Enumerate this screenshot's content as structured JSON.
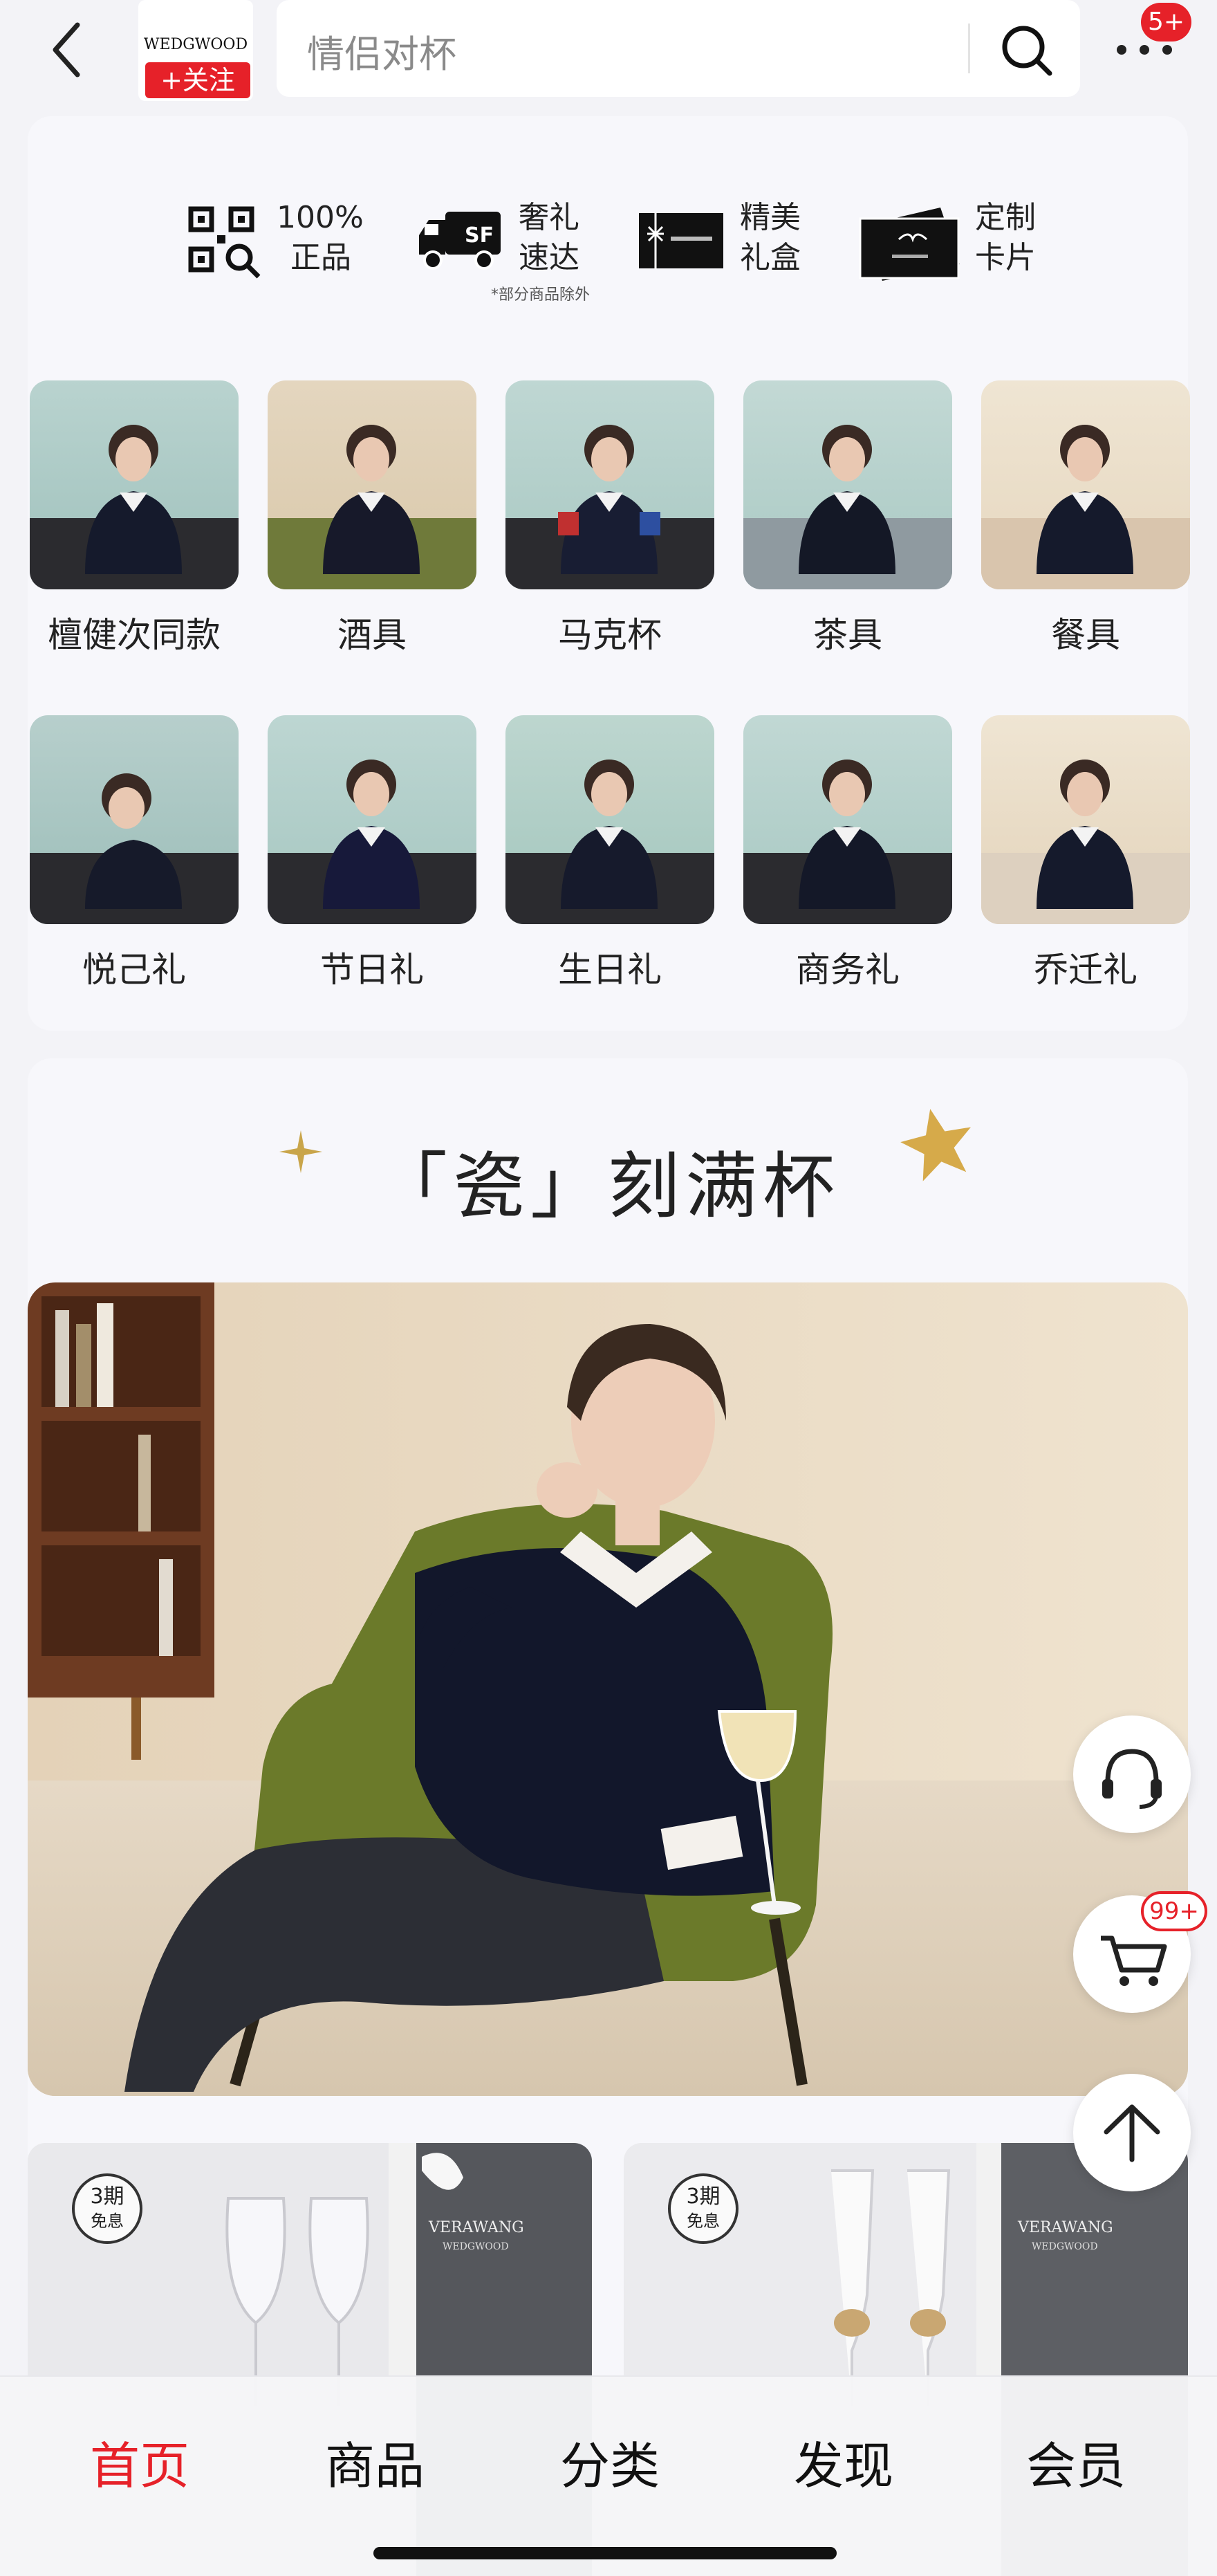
{
  "header": {
    "search_placeholder": "情侣对杯",
    "brand_logo_text": "WEDGWOOD",
    "follow_label": "+关注",
    "more_badge": "5+"
  },
  "features": [
    {
      "icon": "qr-scan-icon",
      "lines": [
        "100%",
        "正品"
      ]
    },
    {
      "icon": "sf-truck-icon",
      "lines": [
        "奢礼",
        "速达"
      ],
      "note": "*部分商品除外"
    },
    {
      "icon": "gift-box-icon",
      "lines": [
        "精美",
        "礼盒"
      ]
    },
    {
      "icon": "card-icon",
      "lines": [
        "定制",
        "卡片"
      ]
    }
  ],
  "categories_row1": [
    {
      "label": "檀健次同款"
    },
    {
      "label": "酒具"
    },
    {
      "label": "马克杯"
    },
    {
      "label": "茶具"
    },
    {
      "label": "餐具"
    }
  ],
  "categories_row2": [
    {
      "label": "悦己礼"
    },
    {
      "label": "节日礼"
    },
    {
      "label": "生日礼"
    },
    {
      "label": "商务礼"
    },
    {
      "label": "乔迁礼"
    }
  ],
  "section": {
    "title": "「瓷」刻满杯"
  },
  "products": [
    {
      "badge_top": "3期",
      "badge_bottom": "免息",
      "box_text": "VERAWANG",
      "box_sub": "WEDGWOOD"
    },
    {
      "badge_top": "3期",
      "badge_bottom": "免息",
      "box_text": "VERAWANG",
      "box_sub": "WEDGWOOD"
    }
  ],
  "floating": {
    "cart_badge": "99+"
  },
  "bottom_nav": [
    {
      "label": "首页",
      "active": true
    },
    {
      "label": "商品"
    },
    {
      "label": "分类"
    },
    {
      "label": "发现"
    },
    {
      "label": "会员"
    }
  ],
  "colors": {
    "accent": "#e62129",
    "background": "#f3f3f7",
    "card": "#f7f7fb"
  }
}
